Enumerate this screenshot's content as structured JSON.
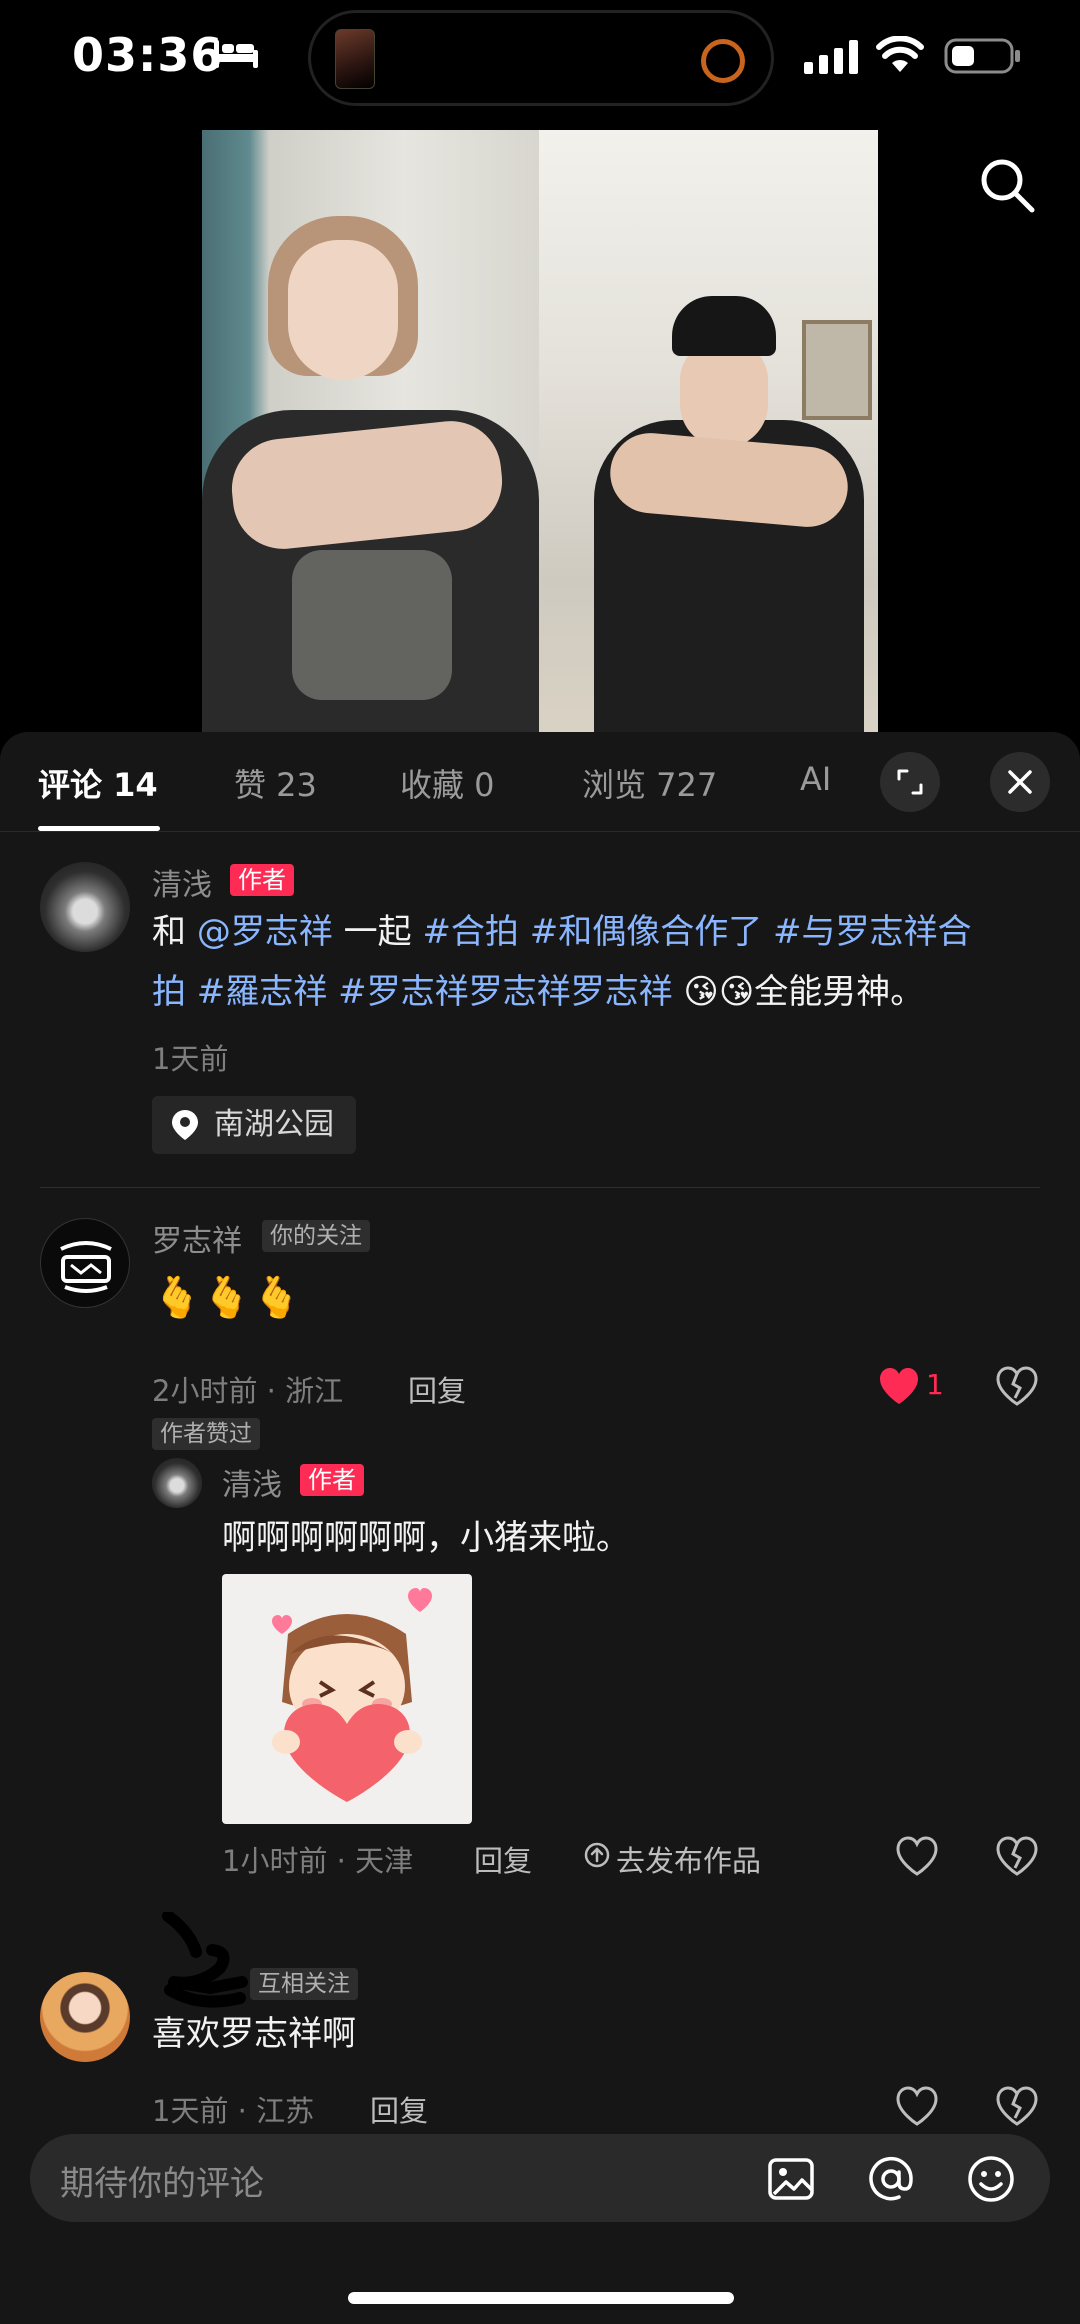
{
  "status_bar": {
    "time": "03:36"
  },
  "tabs": [
    {
      "label": "评论 14"
    },
    {
      "label": "赞 23"
    },
    {
      "label": "收藏 0"
    },
    {
      "label": "浏览 727"
    },
    {
      "label": "AI"
    }
  ],
  "author_post": {
    "name": "清浅",
    "badge": "作者",
    "text_prefix": "和 ",
    "mention": "@罗志祥",
    "text_mid": " 一起 ",
    "tags_line1": "#合拍 #和偶像合作了 #与罗志祥合",
    "tags_line2": "拍 #羅志祥 #罗志祥罗志祥罗志祥",
    "emojis": "😘😘",
    "text_suffix": "全能男神。",
    "time": "1天前",
    "location": "南湖公园"
  },
  "comment1": {
    "name": "罗志祥",
    "badge": "你的关注",
    "text": "🫰🫰🫰",
    "meta": "2小时前 · 浙江",
    "reply_label": "回复",
    "likes": "1",
    "author_liked": "作者赞过"
  },
  "reply1": {
    "name": "清浅",
    "badge": "作者",
    "text": "啊啊啊啊啊啊，小猪来啦。",
    "meta": "1小时前 · 天津",
    "reply_label": "回复",
    "publish_label": "去发布作品"
  },
  "comment2": {
    "badge": "互相关注",
    "text": "喜欢罗志祥啊",
    "meta": "1天前 · 江苏",
    "reply_label": "回复"
  },
  "input": {
    "placeholder": "期待你的评论"
  },
  "colors": {
    "accent": "#fe2c55",
    "tag": "#8ab6ff",
    "panel_bg": "#161616"
  }
}
